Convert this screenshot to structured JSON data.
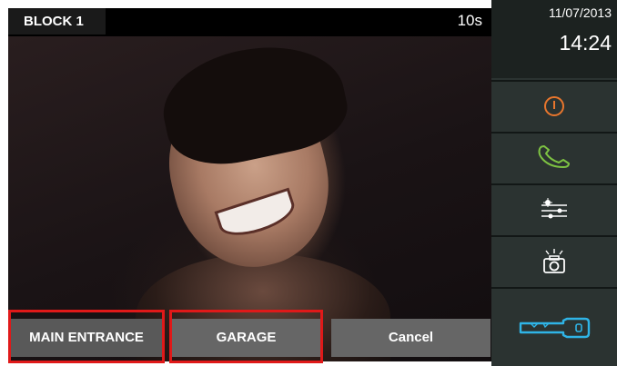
{
  "header": {
    "block_label": "BLOCK 1",
    "timer": "10s"
  },
  "clock": {
    "date": "11/07/2013",
    "time": "14:24"
  },
  "sidebar": {
    "items": [
      {
        "name": "power-icon",
        "color": "#e8762d"
      },
      {
        "name": "phone-icon",
        "color": "#7dc242"
      },
      {
        "name": "sliders-icon",
        "color": "#ffffff"
      },
      {
        "name": "camera-icon",
        "color": "#ffffff"
      },
      {
        "name": "key-icon",
        "color": "#2fb4e6"
      }
    ]
  },
  "buttons": {
    "main_entrance": "MAIN ENTRANCE",
    "garage": "GARAGE",
    "cancel": "Cancel"
  },
  "highlight_color": "#e01919"
}
